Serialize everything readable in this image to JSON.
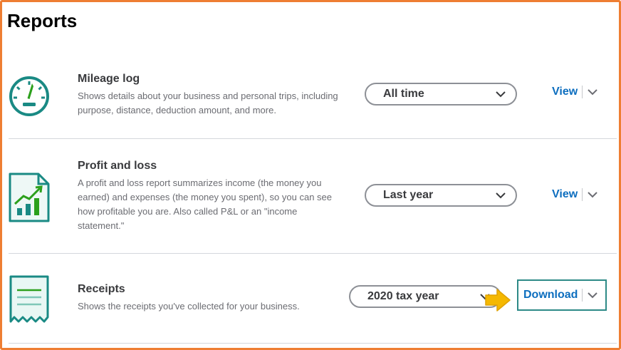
{
  "page": {
    "title": "Reports"
  },
  "reports": [
    {
      "name": "Mileage log",
      "description": "Shows details about your business and personal trips, including purpose, distance, deduction amount, and more.",
      "period": "All time",
      "action": "View",
      "icon": "speedometer-icon"
    },
    {
      "name": "Profit and loss",
      "description": "A profit and loss report summarizes income (the money you earned) and expenses (the money you spent), so you can see how profitable you are. Also called P&L or an \"income statement.\"",
      "period": "Last year",
      "action": "View",
      "icon": "chart-document-icon"
    },
    {
      "name": "Receipts",
      "description": "Shows the receipts you've collected for your business.",
      "period": "2020 tax year",
      "action": "Download",
      "icon": "receipt-icon",
      "highlighted": true
    }
  ],
  "colors": {
    "frame": "#ee7e33",
    "icon_teal": "#1a8a84",
    "chart_green": "#2ca01c",
    "link_blue": "#0d6ebf",
    "highlight_border": "#2d8a87",
    "pointer_yellow": "#f5b800"
  }
}
